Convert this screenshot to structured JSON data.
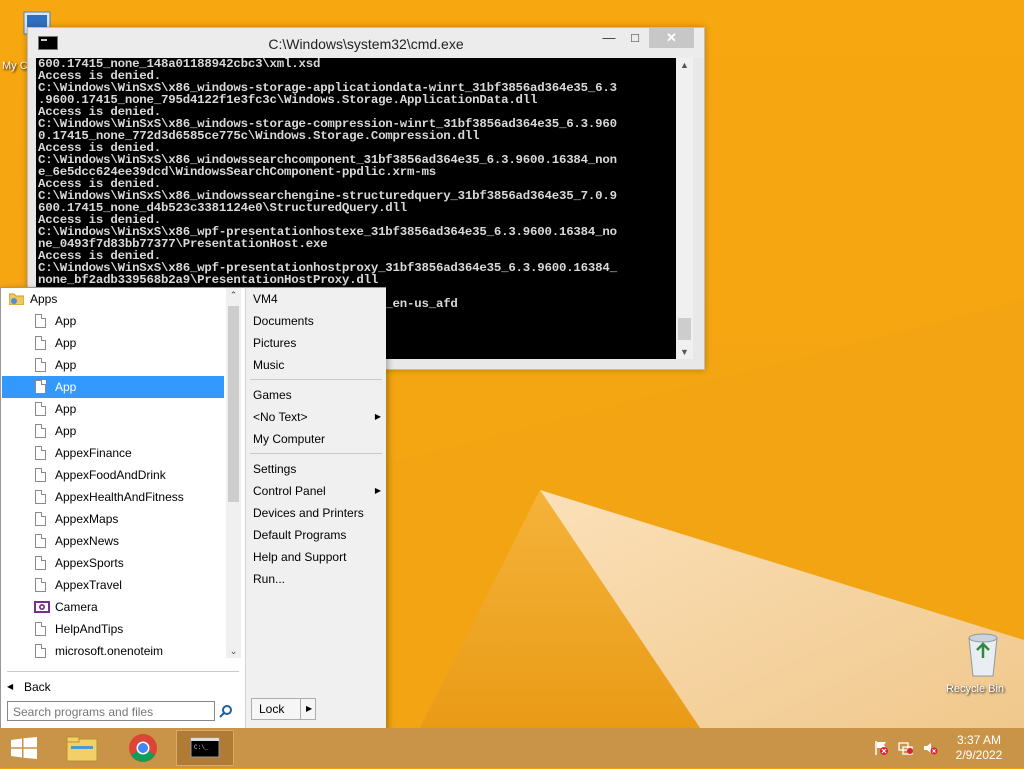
{
  "desktop": {
    "icons": [
      {
        "label": "My C"
      },
      {
        "label": "Recycle Bin"
      }
    ]
  },
  "cmd": {
    "title": "C:\\Windows\\system32\\cmd.exe",
    "lines": [
      "600.17415_none_148a01188942cbc3\\xml.xsd",
      "Access is denied.",
      "C:\\Windows\\WinSxS\\x86_windows-storage-applicationdata-winrt_31bf3856ad364e35_6.3",
      ".9600.17415_none_795d4122f1e3fc3c\\Windows.Storage.ApplicationData.dll",
      "Access is denied.",
      "C:\\Windows\\WinSxS\\x86_windows-storage-compression-winrt_31bf3856ad364e35_6.3.960",
      "0.17415_none_772d3d6585ce775c\\Windows.Storage.Compression.dll",
      "Access is denied.",
      "C:\\Windows\\WinSxS\\x86_windowssearchcomponent_31bf3856ad364e35_6.3.9600.16384_non",
      "e_6e5dcc624ee39dcd\\WindowsSearchComponent-ppdlic.xrm-ms",
      "Access is denied.",
      "C:\\Windows\\WinSxS\\x86_windowssearchengine-structuredquery_31bf3856ad364e35_7.0.9",
      "600.17415_none_d4b523c3381124e0\\StructuredQuery.dll",
      "Access is denied.",
      "C:\\Windows\\WinSxS\\x86_wpf-presentationhostexe_31bf3856ad364e35_6.3.9600.16384_no",
      "ne_0493f7d83bb77377\\PresentationHost.exe",
      "Access is denied.",
      "C:\\Windows\\WinSxS\\x86_wpf-presentationhostproxy_31bf3856ad364e35_6.3.9600.16384_",
      "none_bf2adb339568b2a9\\PresentationHostProxy.dll",
      "",
      "                      856ad364e35_6.3.9600.16384_en-us_afd"
    ]
  },
  "startmenu": {
    "header": "Apps",
    "items": [
      {
        "label": "App"
      },
      {
        "label": "App"
      },
      {
        "label": "App"
      },
      {
        "label": "App"
      },
      {
        "label": "App"
      },
      {
        "label": "App"
      },
      {
        "label": "AppexFinance"
      },
      {
        "label": "AppexFoodAndDrink"
      },
      {
        "label": "AppexHealthAndFitness"
      },
      {
        "label": "AppexMaps"
      },
      {
        "label": "AppexNews"
      },
      {
        "label": "AppexSports"
      },
      {
        "label": "AppexTravel"
      },
      {
        "label": "Camera"
      },
      {
        "label": "HelpAndTips"
      },
      {
        "label": "microsoft.onenoteim"
      }
    ],
    "back_label": "Back",
    "search_placeholder": "Search programs and files",
    "right": {
      "group1": [
        "VM4",
        "Documents",
        "Pictures",
        "Music"
      ],
      "group2": [
        "Games",
        "<No Text>",
        "My Computer"
      ],
      "group3": [
        "Settings",
        "Control Panel",
        "Devices and Printers",
        "Default Programs",
        "Help and Support",
        "Run..."
      ]
    },
    "lock_label": "Lock"
  },
  "taskbar": {
    "time": "3:37 AM",
    "date": "2/9/2022"
  }
}
